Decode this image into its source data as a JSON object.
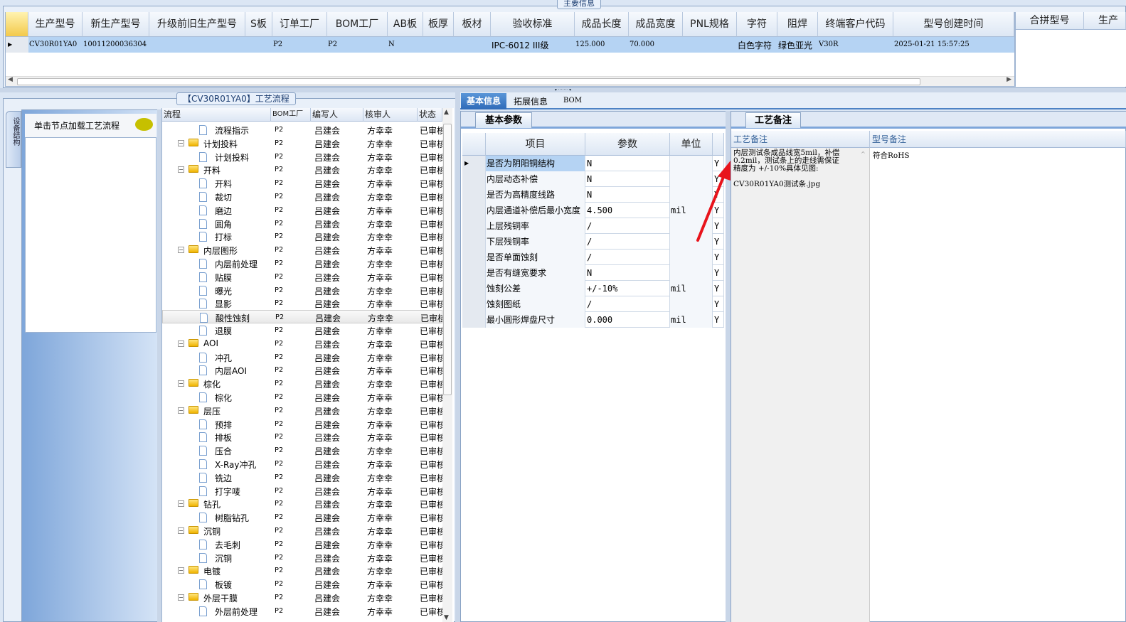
{
  "main_group": {
    "caption": "主要信息",
    "columns": [
      "生产型号",
      "新生产型号",
      "升级前旧生产型号",
      "S板",
      "订单工厂",
      "BOM工厂",
      "AB板",
      "板厚",
      "板材",
      "验收标准",
      "成品长度",
      "成品宽度",
      "PNL规格",
      "字符",
      "阻焊",
      "终端客户代码",
      "型号创建时间"
    ],
    "row": [
      "CV30R01YA0",
      "10011200036304",
      "",
      "",
      "P2",
      "P2",
      "N",
      "",
      "",
      "IPC-6012 III级",
      "125.000",
      "70.000",
      "",
      "白色字符",
      "绿色亚光",
      "V30R",
      "2025-01-21 15:57:25"
    ],
    "side_columns": [
      "合拼型号",
      "生产"
    ]
  },
  "flow_group": {
    "caption": "【CV30R01YA0】工艺流程",
    "side_tab": "设备结构",
    "hint": "单击节点加载工艺流程",
    "columns": [
      "流程",
      "BOM工厂",
      "编写人",
      "核审人",
      "状态"
    ],
    "rows": [
      {
        "n": "流程指示",
        "l": 2
      },
      {
        "n": "计划投料",
        "l": 1
      },
      {
        "n": "计划投料",
        "l": 2
      },
      {
        "n": "开料",
        "l": 1
      },
      {
        "n": "开料",
        "l": 2
      },
      {
        "n": "裁切",
        "l": 2
      },
      {
        "n": "磨边",
        "l": 2
      },
      {
        "n": "圆角",
        "l": 2
      },
      {
        "n": "打标",
        "l": 2
      },
      {
        "n": "内层图形",
        "l": 1
      },
      {
        "n": "内层前处理",
        "l": 2
      },
      {
        "n": "贴膜",
        "l": 2
      },
      {
        "n": "曝光",
        "l": 2
      },
      {
        "n": "显影",
        "l": 2
      },
      {
        "n": "酸性蚀刻",
        "l": 2,
        "sel": true
      },
      {
        "n": "退膜",
        "l": 2
      },
      {
        "n": "AOI",
        "l": 1
      },
      {
        "n": "冲孔",
        "l": 2
      },
      {
        "n": "内层AOI",
        "l": 2
      },
      {
        "n": "棕化",
        "l": 1
      },
      {
        "n": "棕化",
        "l": 2
      },
      {
        "n": "层压",
        "l": 1
      },
      {
        "n": "预排",
        "l": 2
      },
      {
        "n": "排板",
        "l": 2
      },
      {
        "n": "压合",
        "l": 2
      },
      {
        "n": "X-Ray冲孔",
        "l": 2
      },
      {
        "n": "铣边",
        "l": 2
      },
      {
        "n": "打字唛",
        "l": 2
      },
      {
        "n": "钻孔",
        "l": 1
      },
      {
        "n": "树脂钻孔",
        "l": 2
      },
      {
        "n": "沉铜",
        "l": 1
      },
      {
        "n": "去毛刺",
        "l": 2
      },
      {
        "n": "沉铜",
        "l": 2
      },
      {
        "n": "电镀",
        "l": 1
      },
      {
        "n": "板镀",
        "l": 2
      },
      {
        "n": "外层干膜",
        "l": 1
      },
      {
        "n": "外层前处理",
        "l": 2
      }
    ],
    "bom": "P2",
    "writer": "吕建会",
    "reviewer": "方幸幸",
    "status": "已审核"
  },
  "tabs": [
    "基本信息",
    "拓展信息",
    "BOM"
  ],
  "params": {
    "tab": "基本参数",
    "columns": [
      "项目",
      "参数",
      "单位"
    ],
    "rows": [
      [
        "是否为阴阳铜结构",
        "N",
        "",
        "Y"
      ],
      [
        "内层动态补偿",
        "N",
        "",
        "Y"
      ],
      [
        "是否为高精度线路",
        "N",
        "",
        "Y"
      ],
      [
        "内层通道补偿后最小宽度",
        "4.500",
        "mil",
        "Y"
      ],
      [
        "上层残铜率",
        "/",
        "",
        "Y"
      ],
      [
        "下层残铜率",
        "/",
        "",
        "Y"
      ],
      [
        "是否单面蚀刻",
        "/",
        "",
        "Y"
      ],
      [
        "是否有缝宽要求",
        "N",
        "",
        "Y"
      ],
      [
        "蚀刻公差",
        "+/-10%",
        "mil",
        "Y"
      ],
      [
        "蚀刻图纸",
        "/",
        "",
        "Y"
      ],
      [
        "最小圆形焊盘尺寸",
        "0.000",
        "mil",
        "Y"
      ]
    ]
  },
  "remarks": {
    "tab": "工艺备注",
    "columns": [
      "工艺备注",
      "型号备注"
    ],
    "process_note": [
      "内层测试条成品线宽5mil，补偿",
      "0.2mil，测试条上的走线需保证",
      "精度为 +/-10%具体见图:",
      "",
      "CV30R01YA0测试条.jpg"
    ],
    "model_note": "符合RoHS"
  },
  "colors": {
    "selected_row": "#b5d3f3",
    "header": "#dde7f4",
    "annotation_arrow": "#e8141c"
  }
}
